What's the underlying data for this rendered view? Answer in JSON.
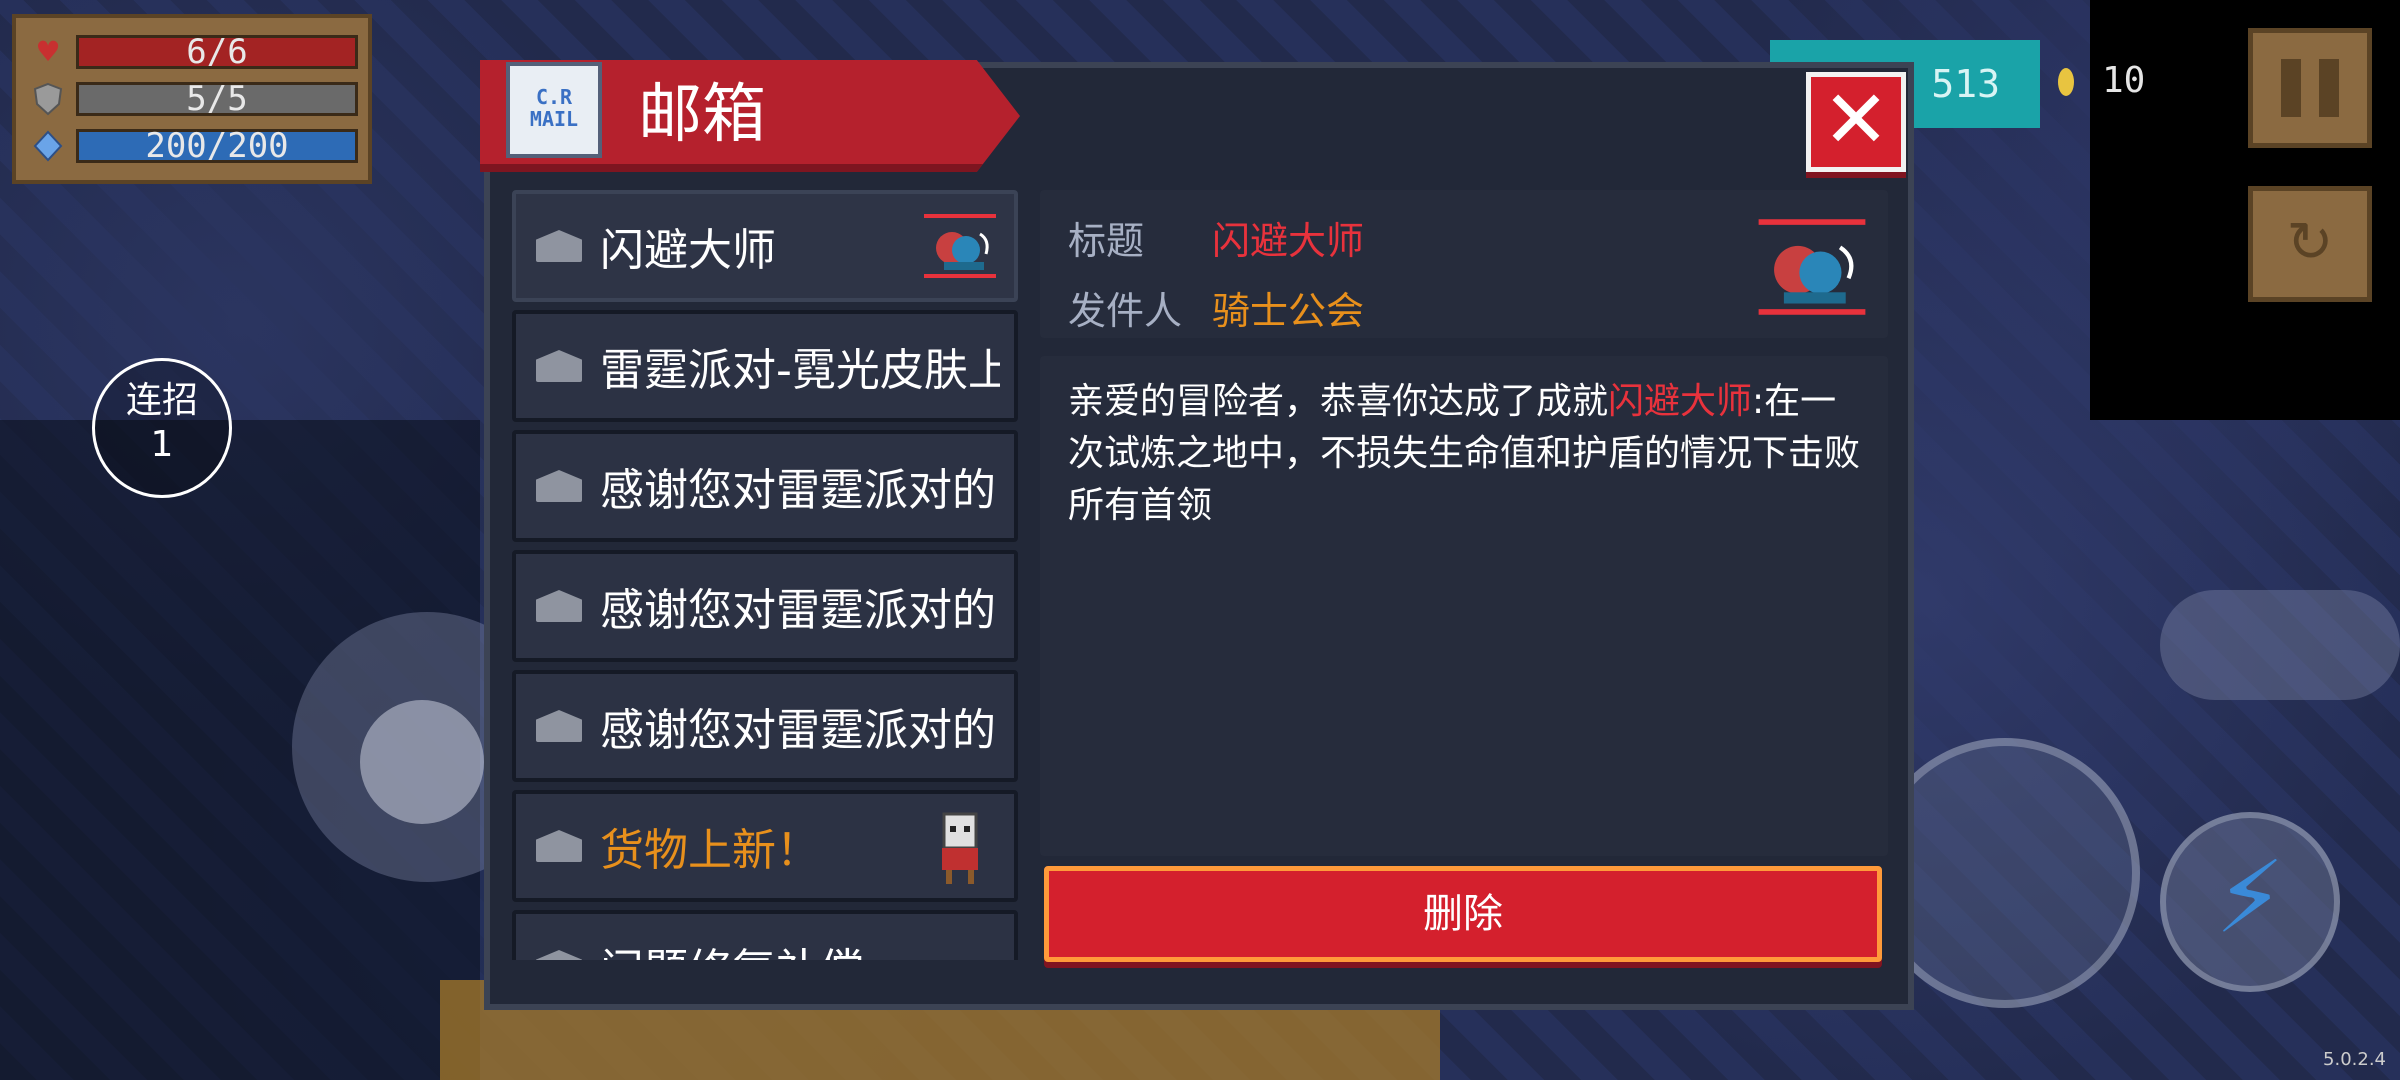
{
  "hud": {
    "hp": "6/6",
    "armor": "5/5",
    "energy": "200/200",
    "combo_label": "连招",
    "combo_count": "1",
    "gem_count": "513",
    "coin_count": "10",
    "version": "5.0.2.4"
  },
  "mailbox": {
    "title": "邮箱",
    "icon_text": "C.R\nMAIL",
    "close_symbol": "✕",
    "items": [
      {
        "label": "闪避大师",
        "color": "#e8323c"
      },
      {
        "label": "雷霆派对-霓光皮肤上",
        "color": "#ffffff"
      },
      {
        "label": "感谢您对雷霆派对的",
        "color": "#ffffff"
      },
      {
        "label": "感谢您对雷霆派对的",
        "color": "#ffffff"
      },
      {
        "label": "感谢您对雷霆派对的",
        "color": "#ffffff"
      },
      {
        "label": "货物上新！",
        "color": "#e8901c"
      },
      {
        "label": "问题修复补偿",
        "color": "#ffffff"
      }
    ],
    "detail": {
      "title_label": "标题",
      "title_value": "闪避大师",
      "sender_label": "发件人",
      "sender_value": "骑士公会",
      "body_before": "亲爱的冒险者，恭喜你达成了成就",
      "body_highlight": "闪避大师",
      "body_after": ":在一次试炼之地中，不损失生命值和护盾的情况下击败所有首领"
    },
    "delete_label": "删除"
  },
  "icons": {
    "heart": "heart-icon",
    "shield": "shield-icon",
    "energy": "energy-crystal-icon",
    "envelope": "envelope-icon",
    "lightning": "lightning-icon"
  }
}
